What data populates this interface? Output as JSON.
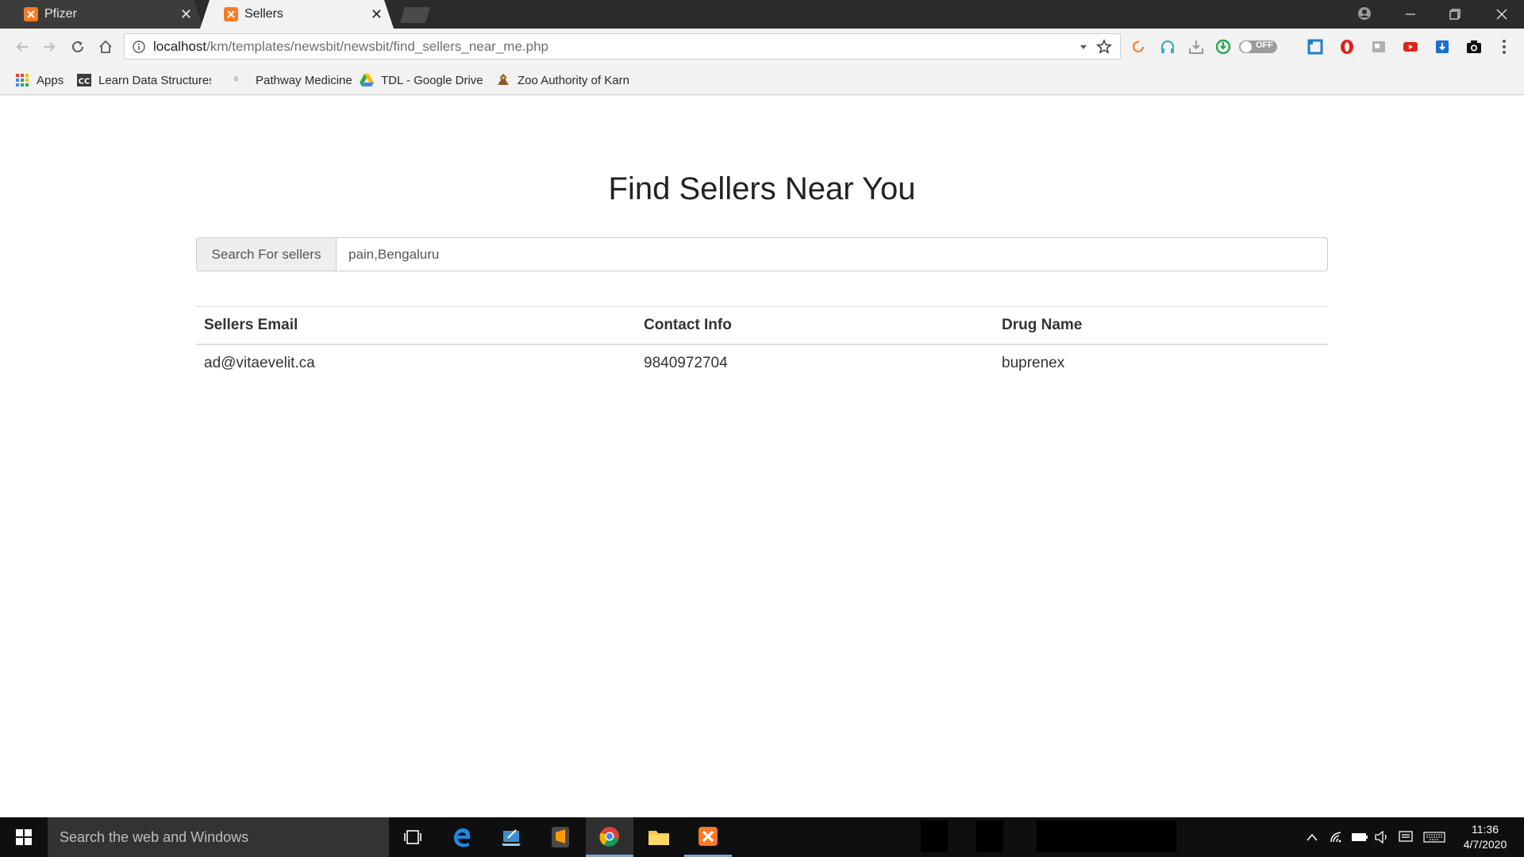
{
  "browser": {
    "tabs": [
      {
        "title": "Pfizer",
        "active": false
      },
      {
        "title": "Sellers",
        "active": true
      }
    ],
    "address": {
      "host": "localhost",
      "path": "/km/templates/newsbit/newsbit/find_sellers_near_me.php"
    },
    "extension_toggle_label": "OFF",
    "bookmarks": [
      {
        "label": "Apps",
        "icon": "apps-grid-icon"
      },
      {
        "label": "Learn Data Structures",
        "icon": "cc-icon"
      },
      {
        "label": "Pathway Medicine",
        "icon": "folder-icon"
      },
      {
        "label": "TDL - Google Drive",
        "icon": "google-drive-icon"
      },
      {
        "label": "Zoo Authority of Karn",
        "icon": "emblem-icon"
      }
    ]
  },
  "page": {
    "title": "Find Sellers Near You",
    "search": {
      "addon_label": "Search For sellers",
      "value": "pain,Bengaluru"
    },
    "table": {
      "headers": [
        "Sellers Email",
        "Contact Info",
        "Drug Name"
      ],
      "rows": [
        [
          "ad@vitaevelit.ca",
          "9840972704",
          "buprenex"
        ]
      ]
    }
  },
  "taskbar": {
    "search_placeholder": "Search the web and Windows",
    "time": "11:36",
    "date": "4/7/2020"
  },
  "colors": {
    "xampp_orange": "#fb7a24",
    "tabstrip": "#2b2b2b",
    "toolbar": "#f2f2f2",
    "taskbar": "#0f0f0f"
  }
}
